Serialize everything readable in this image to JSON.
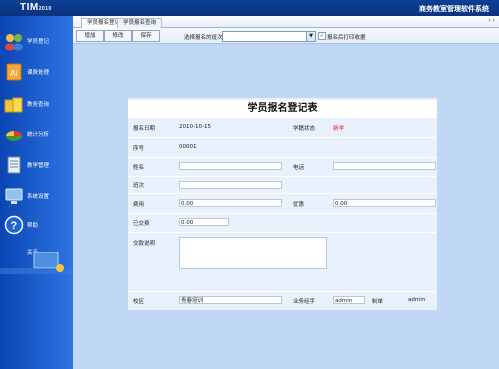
{
  "app": {
    "logo": "TIM",
    "logo_sub": "2010",
    "title": "商务教室管理软件系统"
  },
  "sidebar": {
    "items": [
      {
        "label": "学员登记",
        "icon": "users-icon"
      },
      {
        "label": "课费处理",
        "icon": "document-icon"
      },
      {
        "label": "教务查询",
        "icon": "folders-icon"
      },
      {
        "label": "统计分析",
        "icon": "pie-chart-icon"
      },
      {
        "label": "教学管理",
        "icon": "book-icon"
      },
      {
        "label": "系统设置",
        "icon": "monitor-icon"
      },
      {
        "label": "帮助",
        "icon": "help-icon"
      },
      {
        "label": "关于",
        "icon": "about-icon"
      }
    ]
  },
  "tabs": [
    {
      "label": "学员报名登记",
      "active": true
    },
    {
      "label": "学员报名查询",
      "active": false
    }
  ],
  "toolbar": {
    "new_label": "增加",
    "modify_label": "修改",
    "save_label": "保存",
    "class_label": "选择报名的班次",
    "class_value": "",
    "checkbox_label": "报名后打印收据",
    "checkbox_checked": true
  },
  "form": {
    "title": "学员报名登记表",
    "date_label": "报名日期",
    "date_value": "2010-10-15",
    "status_label": "学籍状态",
    "status_value": "新学",
    "seq_label": "序号",
    "seq_value": "00001",
    "name_label": "姓名",
    "name_value": "",
    "phone_label": "电话",
    "phone_value": "",
    "class_label": "班次",
    "class_value": "",
    "fee_label": "费用",
    "fee_value": "0.00",
    "discount_label": "优惠",
    "discount_value": "0.00",
    "paid_label": "已交费",
    "paid_value": "0.00",
    "remark_label": "交款说明",
    "remark_value": "",
    "campus_label": "校区",
    "campus_value": "青春培训",
    "agent_label": "业务经手",
    "agent_value": "admin",
    "maker_label": "制单",
    "maker_value": "admin"
  },
  "colors": {
    "titlebar": "#0d3f96",
    "sidebar": "#2f74e4",
    "main_bg": "#c0d8f4",
    "form_bg": "#e8f1fc",
    "status_red": "#e0151b"
  }
}
